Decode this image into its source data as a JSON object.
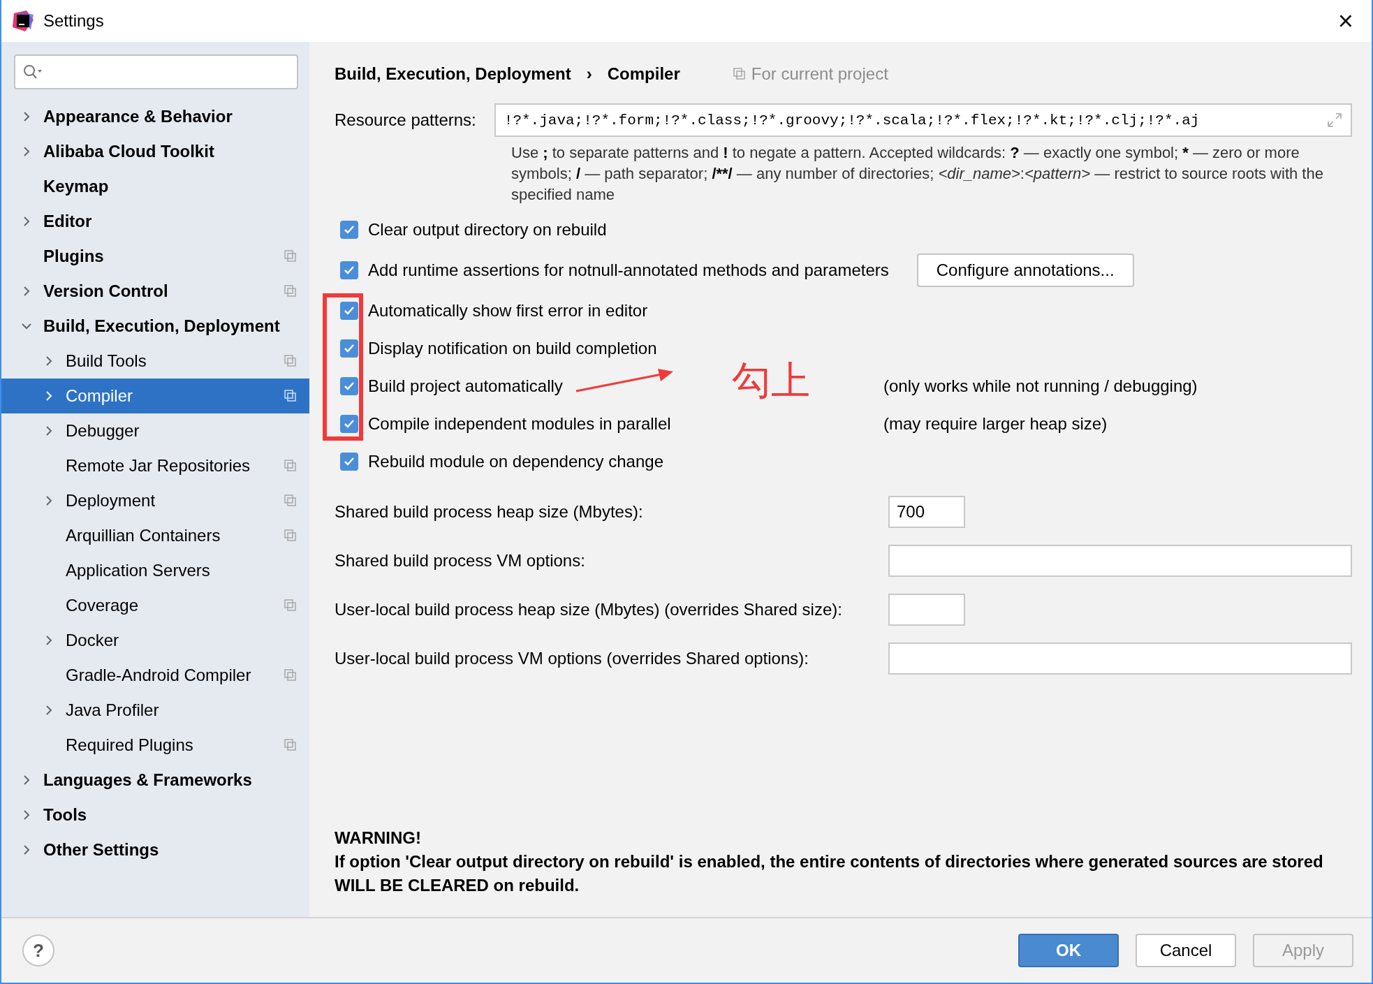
{
  "window": {
    "title": "Settings",
    "close": "×"
  },
  "sidebar": {
    "items": [
      {
        "label": "Appearance & Behavior",
        "expandable": true,
        "expanded": false,
        "selected": false,
        "project_level": false
      },
      {
        "label": "Alibaba Cloud Toolkit",
        "expandable": true,
        "expanded": false,
        "selected": false,
        "project_level": false
      },
      {
        "label": "Keymap",
        "expandable": false,
        "selected": false,
        "project_level": false
      },
      {
        "label": "Editor",
        "expandable": true,
        "expanded": false,
        "selected": false,
        "project_level": false
      },
      {
        "label": "Plugins",
        "expandable": false,
        "selected": false,
        "project_level": true
      },
      {
        "label": "Version Control",
        "expandable": true,
        "expanded": false,
        "selected": false,
        "project_level": true
      },
      {
        "label": "Build, Execution, Deployment",
        "expandable": true,
        "expanded": true,
        "selected": false,
        "project_level": false,
        "children": [
          {
            "label": "Build Tools",
            "expandable": true,
            "expanded": false,
            "selected": false,
            "project_level": true
          },
          {
            "label": "Compiler",
            "expandable": true,
            "expanded": false,
            "selected": true,
            "project_level": true
          },
          {
            "label": "Debugger",
            "expandable": true,
            "expanded": false,
            "selected": false,
            "project_level": false
          },
          {
            "label": "Remote Jar Repositories",
            "expandable": false,
            "selected": false,
            "project_level": true
          },
          {
            "label": "Deployment",
            "expandable": true,
            "expanded": false,
            "selected": false,
            "project_level": true
          },
          {
            "label": "Arquillian Containers",
            "expandable": false,
            "selected": false,
            "project_level": true
          },
          {
            "label": "Application Servers",
            "expandable": false,
            "selected": false,
            "project_level": false
          },
          {
            "label": "Coverage",
            "expandable": false,
            "selected": false,
            "project_level": true
          },
          {
            "label": "Docker",
            "expandable": true,
            "expanded": false,
            "selected": false,
            "project_level": false
          },
          {
            "label": "Gradle-Android Compiler",
            "expandable": false,
            "selected": false,
            "project_level": true
          },
          {
            "label": "Java Profiler",
            "expandable": true,
            "expanded": false,
            "selected": false,
            "project_level": false
          },
          {
            "label": "Required Plugins",
            "expandable": false,
            "selected": false,
            "project_level": true
          }
        ]
      },
      {
        "label": "Languages & Frameworks",
        "expandable": true,
        "expanded": false,
        "selected": false,
        "project_level": false
      },
      {
        "label": "Tools",
        "expandable": true,
        "expanded": false,
        "selected": false,
        "project_level": false
      },
      {
        "label": "Other Settings",
        "expandable": true,
        "expanded": false,
        "selected": false,
        "project_level": false
      }
    ]
  },
  "breadcrumb": {
    "parent": "Build, Execution, Deployment",
    "separator": "›",
    "current": "Compiler",
    "scope": "For current project"
  },
  "resource_patterns": {
    "label": "Resource patterns:",
    "value": "!?*.java;!?*.form;!?*.class;!?*.groovy;!?*.scala;!?*.flex;!?*.kt;!?*.clj;!?*.aj",
    "help": [
      {
        "text": "Use ",
        "kind": "plain"
      },
      {
        "text": ";",
        "kind": "bold"
      },
      {
        "text": " to separate patterns and ",
        "kind": "plain"
      },
      {
        "text": "!",
        "kind": "bold"
      },
      {
        "text": " to negate a pattern. Accepted wildcards: ",
        "kind": "plain"
      },
      {
        "text": "?",
        "kind": "bold"
      },
      {
        "text": " — exactly one symbol; ",
        "kind": "plain"
      },
      {
        "text": "*",
        "kind": "bold"
      },
      {
        "text": " — zero or more symbols; ",
        "kind": "plain"
      },
      {
        "text": "/",
        "kind": "bold"
      },
      {
        "text": " — path separator; ",
        "kind": "plain"
      },
      {
        "text": "/**/",
        "kind": "bold"
      },
      {
        "text": " — any number of directories; ",
        "kind": "plain"
      },
      {
        "text": "<dir_name>",
        "kind": "italic"
      },
      {
        "text": ":",
        "kind": "plain"
      },
      {
        "text": "<pattern>",
        "kind": "italic"
      },
      {
        "text": " — restrict to source roots with the specified name",
        "kind": "plain"
      }
    ]
  },
  "options": [
    {
      "label": "Clear output directory on rebuild",
      "checked": true
    },
    {
      "label": "Add runtime assertions for notnull-annotated methods and parameters",
      "checked": true,
      "button": "Configure annotations..."
    },
    {
      "label": "Automatically show first error in editor",
      "checked": true
    },
    {
      "label": "Display notification on build completion",
      "checked": true
    },
    {
      "label": "Build project automatically",
      "checked": true,
      "note": "(only works while not running / debugging)"
    },
    {
      "label": "Compile independent modules in parallel",
      "checked": true,
      "note": "(may require larger heap size)"
    },
    {
      "label": "Rebuild module on dependency change",
      "checked": true
    }
  ],
  "fields": [
    {
      "label": "Shared build process heap size (Mbytes):",
      "kind": "short",
      "value": "700"
    },
    {
      "label": "Shared build process VM options:",
      "kind": "wide"
    },
    {
      "label": "User-local build process heap size (Mbytes) (overrides Shared size):",
      "kind": "short"
    },
    {
      "label": "User-local build process VM options (overrides Shared options):",
      "kind": "wide"
    }
  ],
  "warning": {
    "title": "WARNING!",
    "text": "If option 'Clear output directory on rebuild' is enabled, the entire contents of directories where generated sources are stored WILL BE CLEARED on rebuild."
  },
  "annotation": {
    "text": "勾上"
  },
  "footer": {
    "help": "?",
    "buttons": [
      {
        "label": "OK",
        "kind": "primary",
        "disabled": false
      },
      {
        "label": "Cancel",
        "kind": "normal",
        "disabled": false
      },
      {
        "label": "Apply",
        "kind": "normal",
        "disabled": true
      }
    ]
  }
}
